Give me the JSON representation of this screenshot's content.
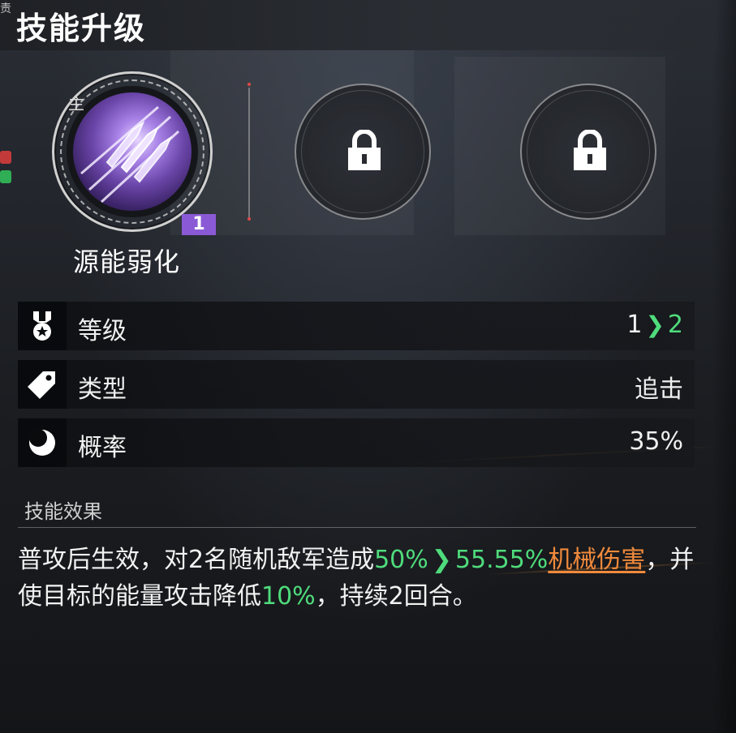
{
  "header": {
    "corner_glyph": "责",
    "title": "技能升级"
  },
  "skills": {
    "main": {
      "tag": "主",
      "name": "源能弱化",
      "level": "1",
      "icon": "bullet-volley-icon",
      "accent_color": "#8a5ad6"
    },
    "locked_slots": [
      {
        "icon": "lock-icon"
      },
      {
        "icon": "lock-icon"
      }
    ]
  },
  "stats": {
    "level": {
      "icon": "medal-icon",
      "label": "等级",
      "from": "1",
      "to": "2"
    },
    "type": {
      "icon": "tag-icon",
      "label": "类型",
      "value": "追击"
    },
    "chance": {
      "icon": "crescent-moon-icon",
      "label": "概率",
      "value": "35%"
    }
  },
  "effect": {
    "heading": "技能效果",
    "text_part1": "普攻后生效，对2名随机敌军造成",
    "dmg_from": "50%",
    "dmg_to": "55.55%",
    "dmg_type": "机械伤害",
    "text_part2": "，并使目标的能量攻击降低",
    "reduce": "10%",
    "text_part3": "，持续2回合。"
  },
  "colors": {
    "upgrade_green": "#4fdc7c",
    "damage_orange": "#f08a3c",
    "level_badge_purple": "#8a5ad6"
  }
}
